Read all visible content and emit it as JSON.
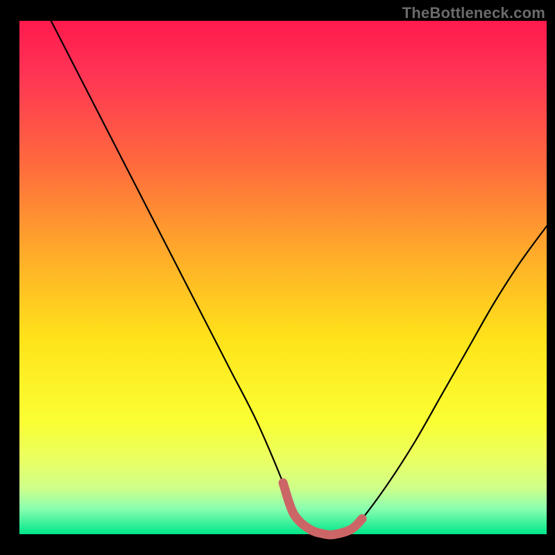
{
  "watermark": "TheBottleneck.com",
  "colors": {
    "background": "#000000",
    "curve_stroke": "#000000",
    "marker_stroke": "#cc6666",
    "gradient_stops": [
      {
        "offset": 0.0,
        "color": "#ff1a4d"
      },
      {
        "offset": 0.1,
        "color": "#ff3355"
      },
      {
        "offset": 0.28,
        "color": "#ff6a3d"
      },
      {
        "offset": 0.45,
        "color": "#ffaa2a"
      },
      {
        "offset": 0.62,
        "color": "#ffe31a"
      },
      {
        "offset": 0.78,
        "color": "#faff33"
      },
      {
        "offset": 0.86,
        "color": "#e8ff66"
      },
      {
        "offset": 0.91,
        "color": "#cfff8a"
      },
      {
        "offset": 0.95,
        "color": "#8affb0"
      },
      {
        "offset": 1.0,
        "color": "#00e68a"
      }
    ]
  },
  "chart_data": {
    "type": "line",
    "title": "",
    "xlabel": "",
    "ylabel": "",
    "xlim": [
      0,
      100
    ],
    "ylim": [
      0,
      100
    ],
    "series": [
      {
        "name": "bottleneck-curve",
        "x": [
          6,
          10,
          15,
          20,
          25,
          30,
          35,
          40,
          45,
          50,
          52,
          55,
          58,
          60,
          63,
          65,
          70,
          75,
          80,
          85,
          90,
          95,
          100
        ],
        "y": [
          100,
          92,
          82,
          72,
          62,
          52,
          42,
          32,
          22,
          10,
          4,
          1,
          0,
          0,
          1,
          3,
          10,
          18,
          27,
          36,
          45,
          53,
          60
        ]
      }
    ],
    "highlight_range": {
      "x_start": 50,
      "x_end": 65,
      "y_approx": 1
    },
    "background_gradient_direction": "top-to-bottom",
    "description": "V-shaped bottleneck curve over a vertical rainbow heat gradient; minimum highlighted with a short thick rounded segment."
  }
}
